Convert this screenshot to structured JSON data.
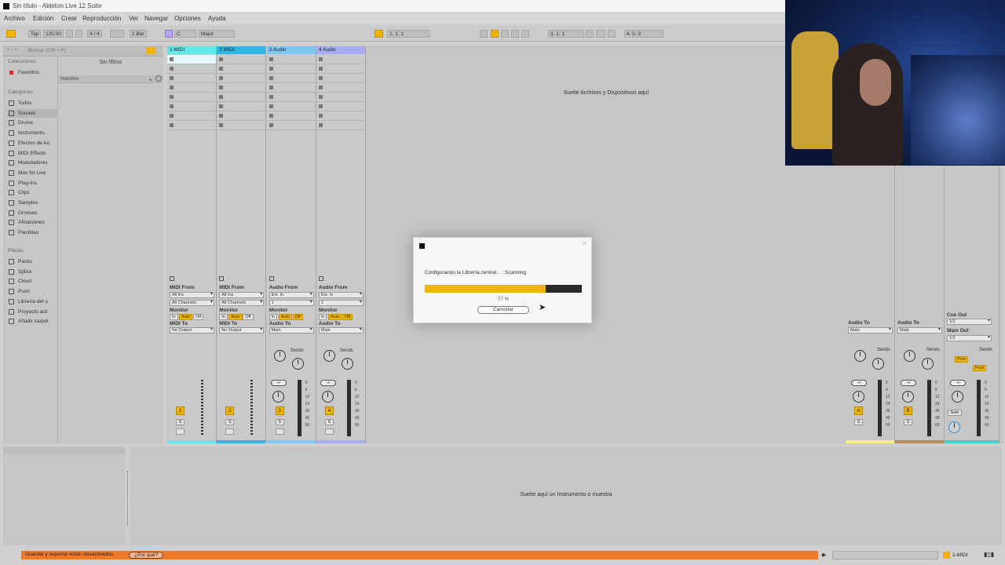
{
  "window": {
    "title": "Sin título - Ableton Live 12 Suite"
  },
  "menu": [
    "Archivo",
    "Edición",
    "Crear",
    "Reproducción",
    "Ver",
    "Navegar",
    "Opciones",
    "Ayuda"
  ],
  "toolbar": {
    "tap": "Tap",
    "tempo": "120.00",
    "signature": "4 / 4",
    "quantize": "1 Bar",
    "key": "C",
    "scale": "Major",
    "position": "1.   1.   1",
    "loop_start": "3.   1.   1",
    "loop_length": "4.   0.   0"
  },
  "browser": {
    "search_placeholder": "Buscar (Ctrl + F)",
    "filters": "Sin filtros",
    "column_name": "Nombre",
    "collections_title": "Colecciones",
    "collections": [
      "Favoritos"
    ],
    "categories_title": "Categorías",
    "categories": [
      "Todos",
      "Sounds",
      "Drums",
      "Instruments",
      "Efectos de Au",
      "MIDI Effects",
      "Moduladores",
      "Max for Live",
      "Plug-Ins",
      "Clips",
      "Samples",
      "Grooves",
      "Afinaciones",
      "Plantillas"
    ],
    "selected_category": "Sounds",
    "places_title": "Places",
    "places": [
      "Packs",
      "Splice",
      "Cloud",
      "Push",
      "Librería del u",
      "Proyecto acti",
      "Añadir carpet"
    ]
  },
  "session": {
    "drop_text": "Suelte Archivos y Dispositivos aquí",
    "tracks": [
      {
        "name": "1 MIDI",
        "color": "#5ee8e8",
        "num": "1",
        "from_label": "MIDI From",
        "from": "All Ins",
        "channel": "All Channels",
        "to_label": "MIDI To",
        "to": "No Output"
      },
      {
        "name": "2 MIDI",
        "color": "#2fb8e6",
        "num": "2",
        "from_label": "MIDI From",
        "from": "All Ins",
        "channel": "All Channels",
        "to_label": "MIDI To",
        "to": "No Output"
      },
      {
        "name": "3 Audio",
        "color": "#7cc8f2",
        "num": "3",
        "from_label": "Audio From",
        "from": "Ext. In",
        "channel": "1",
        "to_label": "Audio To",
        "to": "Main"
      },
      {
        "name": "4 Audio",
        "color": "#a6acf2",
        "num": "4",
        "from_label": "Audio From",
        "from": "Ext. In",
        "channel": "2",
        "to_label": "Audio To",
        "to": "Main"
      }
    ],
    "monitor_label": "Monitor",
    "monitor_options": [
      "In",
      "Auto",
      "Off"
    ],
    "sends_label": "Sends",
    "solo": "S",
    "vol": "-∞",
    "db_scale": [
      "0",
      "6",
      "12",
      "24",
      "36",
      "48",
      "60"
    ],
    "returns": [
      {
        "letter": "A",
        "to_label": "Audio To",
        "to": "Main",
        "color": "#f7f07a"
      },
      {
        "letter": "B",
        "to_label": "Audio To",
        "to": "Main",
        "color": "#b88c62"
      }
    ],
    "main": {
      "cue_label": "Cue Out",
      "cue": "1/2",
      "main_label": "Main Out",
      "main": "1/2",
      "post": "Post",
      "solo": "Solo",
      "color": "#3fd6c8"
    }
  },
  "modal": {
    "text": "Configurando la Librería central... : Scanning",
    "progress": 0.77,
    "percent": "77 %",
    "cancel": "Cancelar"
  },
  "detail": {
    "drop_text": "Suelte aquí un Instrumento o muestra"
  },
  "status": {
    "warning": "Guardar y exportar están desactivados.",
    "why": "¿Por qué?",
    "track": "1-MIDI"
  }
}
